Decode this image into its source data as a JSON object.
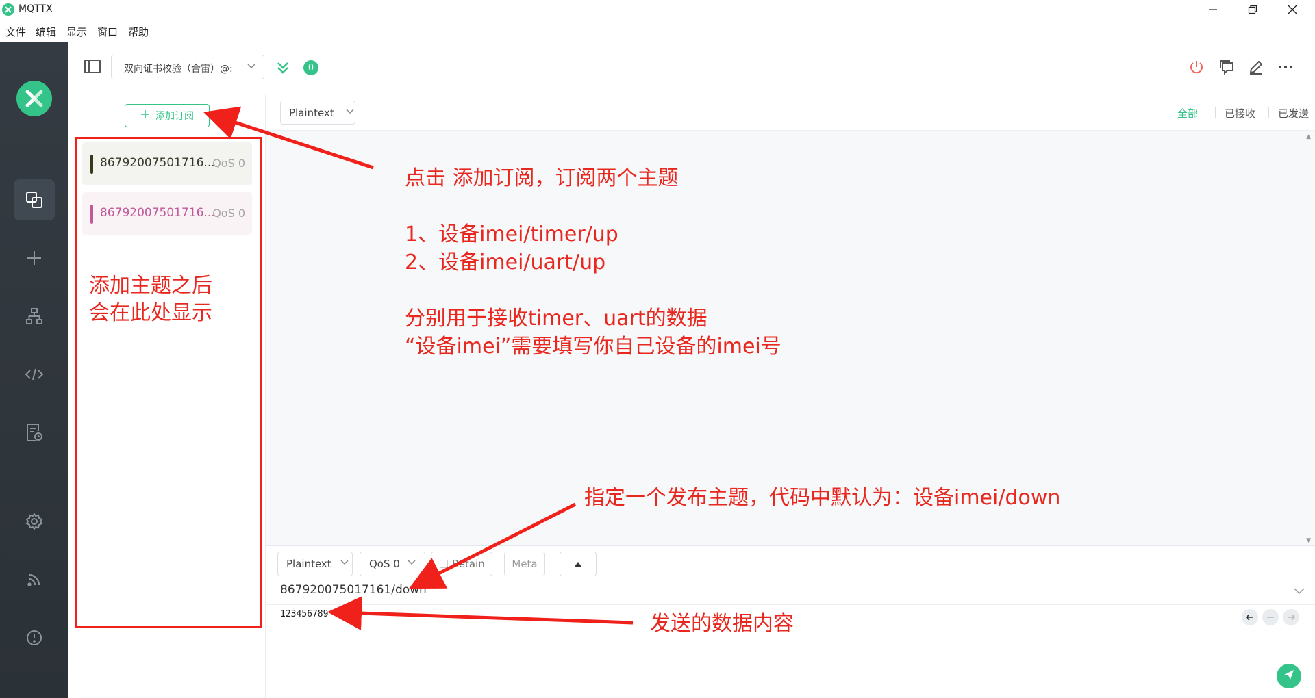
{
  "window": {
    "title": "MQTTX",
    "controls": [
      "minimize-icon",
      "restore-icon",
      "close-icon"
    ]
  },
  "menu": [
    "文件",
    "编辑",
    "显示",
    "窗口",
    "帮助"
  ],
  "sidebar": {
    "items": [
      {
        "name": "connections",
        "icon": "connections-icon"
      },
      {
        "name": "new-connection",
        "icon": "plus-icon"
      },
      {
        "name": "topology",
        "icon": "hierarchy-icon"
      },
      {
        "name": "script",
        "icon": "code-icon"
      },
      {
        "name": "log",
        "icon": "log-icon"
      },
      {
        "name": "settings",
        "icon": "gear-icon"
      },
      {
        "name": "feed",
        "icon": "rss-icon"
      },
      {
        "name": "about",
        "icon": "info-icon"
      }
    ]
  },
  "header": {
    "connection_name": "双向证书校验（合宙）@:",
    "message_count": "0"
  },
  "subscriptions": {
    "add_label": "添加订阅",
    "items": [
      {
        "topic": "86792007501716...",
        "qos": "QoS 0",
        "color": "#3a3a1a"
      },
      {
        "topic": "86792007501716...",
        "qos": "QoS 0",
        "color": "#c05a9a"
      }
    ]
  },
  "messages": {
    "payload_type": "Plaintext",
    "filters": {
      "all": "全部",
      "received": "已接收",
      "sent": "已发送"
    }
  },
  "publish": {
    "payload_type": "Plaintext",
    "qos": "QoS 0",
    "retain_label": "Retain",
    "meta_label": "Meta",
    "topic": "867920075017161/down",
    "payload": "123456789"
  },
  "annotations": {
    "sub_list_note": "添加主题之后\n会在此处显示",
    "main_note": "点击 添加订阅，订阅两个主题\n\n1、设备imei/timer/up\n2、设备imei/uart/up\n\n分别用于接收timer、uart的数据\n“设备imei”需要填写你自己设备的imei号",
    "pub_topic_note": "指定一个发布主题，代码中默认为：设备imei/down",
    "payload_note": "发送的数据内容"
  },
  "colors": {
    "accent": "#34c388",
    "sidebar": "#2f363c",
    "annotation": "#e8281f"
  }
}
